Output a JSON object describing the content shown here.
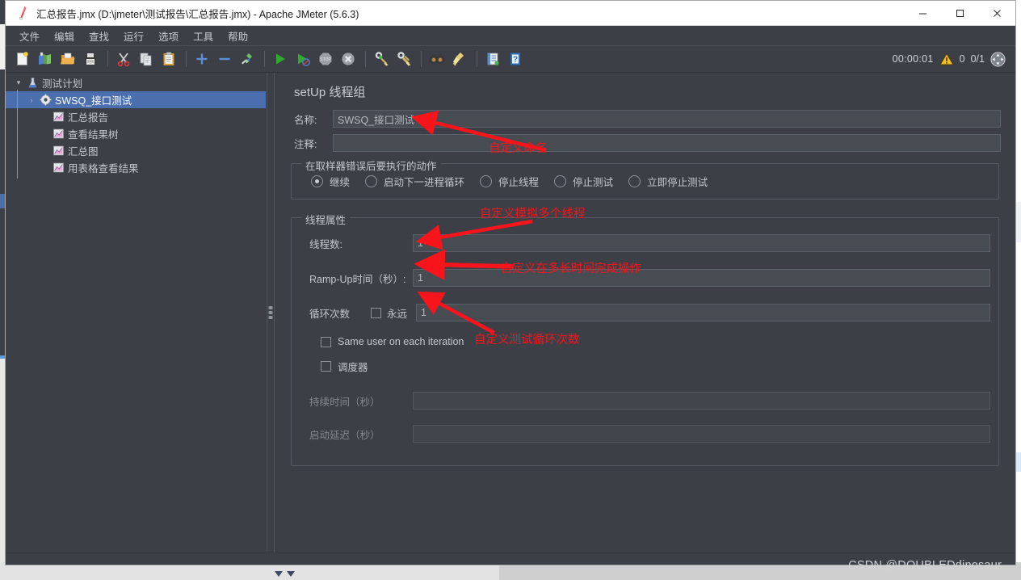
{
  "window": {
    "title": "汇总报告.jmx (D:\\jmeter\\测试报告\\汇总报告.jmx) - Apache JMeter (5.6.3)",
    "app_icon": "jmeter-feather-icon",
    "controls": {
      "minimize": "—",
      "maximize": "□",
      "close": "✕"
    }
  },
  "menubar": {
    "items": [
      {
        "label": "文件",
        "name": "menu-file"
      },
      {
        "label": "编辑",
        "name": "menu-edit"
      },
      {
        "label": "查找",
        "name": "menu-search"
      },
      {
        "label": "运行",
        "name": "menu-run"
      },
      {
        "label": "选项",
        "name": "menu-options"
      },
      {
        "label": "工具",
        "name": "menu-tools"
      },
      {
        "label": "帮助",
        "name": "menu-help"
      }
    ]
  },
  "toolbar": {
    "buttons": [
      {
        "icon": "new-document-icon",
        "name": "new-test-plan-button"
      },
      {
        "icon": "templates-icon",
        "name": "templates-button"
      },
      {
        "icon": "open-folder-icon",
        "name": "open-button"
      },
      {
        "icon": "floppy-save-icon",
        "name": "save-button"
      },
      {
        "icon": "scissors-icon",
        "name": "cut-button"
      },
      {
        "icon": "copy-pages-icon",
        "name": "copy-button"
      },
      {
        "icon": "clipboard-paste-icon",
        "name": "paste-button"
      },
      {
        "icon": "plus-icon",
        "name": "expand-all-button"
      },
      {
        "icon": "minus-icon",
        "name": "collapse-all-button"
      },
      {
        "icon": "toggle-pencil-icon",
        "name": "toggle-button"
      },
      {
        "icon": "play-green-icon",
        "name": "start-button"
      },
      {
        "icon": "play-no-pauses-icon",
        "name": "start-no-pauses-button"
      },
      {
        "icon": "stop-sign-icon",
        "name": "stop-button"
      },
      {
        "icon": "shutdown-x-icon",
        "name": "shutdown-button"
      },
      {
        "icon": "clear-broom-green-icon",
        "name": "clear-button"
      },
      {
        "icon": "clear-all-broom-icon",
        "name": "clear-all-button"
      },
      {
        "icon": "binoculars-icon",
        "name": "search-button"
      },
      {
        "icon": "reset-broom-icon",
        "name": "reset-search-button"
      },
      {
        "icon": "function-helper-icon",
        "name": "function-helper-button"
      },
      {
        "icon": "help-book-icon",
        "name": "help-button"
      }
    ],
    "status": {
      "elapsed_time": "00:00:01",
      "warning_icon": "warning-triangle-icon",
      "warning_count": "0",
      "thread_counts": "0/1",
      "remote_icon": "remote-engines-icon"
    }
  },
  "tree": {
    "nodes": [
      {
        "label": "测试计划",
        "icon": "test-plan-icon",
        "arrow": "▾",
        "indent": 0,
        "selected": false,
        "name": "tree-node-test-plan"
      },
      {
        "label": "SWSQ_接口测试",
        "icon": "thread-group-gear-icon",
        "arrow": "›",
        "indent": 1,
        "selected": true,
        "name": "tree-node-thread-group"
      },
      {
        "label": "汇总报告",
        "icon": "listener-chart-icon",
        "arrow": "",
        "indent": 2,
        "selected": false,
        "name": "tree-node-summary-report"
      },
      {
        "label": "查看结果树",
        "icon": "listener-chart-icon",
        "arrow": "",
        "indent": 2,
        "selected": false,
        "name": "tree-node-view-results-tree"
      },
      {
        "label": "汇总图",
        "icon": "listener-chart-icon",
        "arrow": "",
        "indent": 2,
        "selected": false,
        "name": "tree-node-aggregate-graph"
      },
      {
        "label": "用表格查看结果",
        "icon": "listener-chart-icon",
        "arrow": "",
        "indent": 2,
        "selected": false,
        "name": "tree-node-view-results-table"
      }
    ]
  },
  "panel": {
    "title": "setUp 线程组",
    "name_label": "名称:",
    "name_value": "SWSQ_接口测试",
    "comment_label": "注释:",
    "comment_value": "",
    "error_action": {
      "group_title": "在取样器错误后要执行的动作",
      "options": [
        {
          "label": "继续",
          "checked": true,
          "name": "radio-continue"
        },
        {
          "label": "启动下一进程循环",
          "checked": false,
          "name": "radio-start-next-loop"
        },
        {
          "label": "停止线程",
          "checked": false,
          "name": "radio-stop-thread"
        },
        {
          "label": "停止测试",
          "checked": false,
          "name": "radio-stop-test"
        },
        {
          "label": "立即停止测试",
          "checked": false,
          "name": "radio-stop-test-now"
        }
      ]
    },
    "thread_props": {
      "group_title": "线程属性",
      "num_threads_label": "线程数:",
      "num_threads_value": "1",
      "ramp_up_label": "Ramp-Up时间（秒）:",
      "ramp_up_value": "1",
      "loop_label": "循环次数",
      "loop_forever_label": "永远",
      "loop_forever_checked": false,
      "loop_value": "1",
      "same_user_label": "Same user on each iteration",
      "same_user_checked": false,
      "scheduler_label": "调度器",
      "scheduler_checked": false,
      "duration_label": "持续时间（秒）",
      "duration_value": "",
      "startup_delay_label": "启动延迟（秒）",
      "startup_delay_value": ""
    }
  },
  "annotations": {
    "color": "#f8141b",
    "items": [
      {
        "text": "自定义命名",
        "name": "annotation-custom-name"
      },
      {
        "text": "自定义模拟多个线程",
        "name": "annotation-simulate-threads"
      },
      {
        "text": "自定义在多长时间完成操作",
        "name": "annotation-rampup-time"
      },
      {
        "text": "自定义测试循环次数",
        "name": "annotation-loop-count"
      }
    ]
  },
  "watermark": {
    "text": "CSDN @DOUBLEDdinosaur"
  }
}
